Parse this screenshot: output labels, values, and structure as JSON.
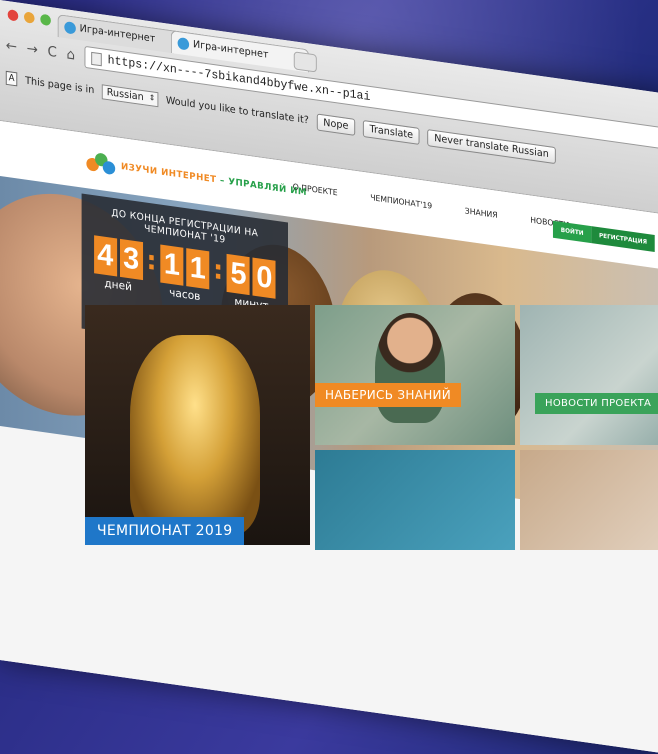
{
  "browser": {
    "tabs": [
      {
        "title": "Игра-интернет"
      },
      {
        "title": "Игра-интернет"
      }
    ],
    "url": "https://xn----7sbikand4bbyfwe.xn--p1ai",
    "translate_bar": {
      "prefix": "This page is in",
      "language": "Russian",
      "question": "Would you like to translate it?",
      "nope": "Nope",
      "translate": "Translate",
      "never": "Never translate Russian"
    }
  },
  "site": {
    "logo": {
      "part1": "ИЗУЧИ ИНТЕРНЕТ",
      "part2": " – УПРАВЛЯЙ ИМ"
    },
    "menu": [
      "О ПРОЕКТЕ",
      "ЧЕМПИОНАТ'19",
      "ЗНАНИЯ",
      "НОВОСТИ"
    ],
    "login": "ВОЙТИ",
    "register": "РЕГИСТРАЦИЯ",
    "countdown": {
      "title": "ДО КОНЦА РЕГИСТРАЦИИ НА ЧЕМПИОНАТ '19",
      "days": [
        "4",
        "3"
      ],
      "hours": [
        "1",
        "1"
      ],
      "minutes": [
        "5",
        "0"
      ],
      "days_label": "дней",
      "hours_label": "часов",
      "minutes_label": "минут"
    },
    "tiles": {
      "knowledge": "НАБЕРИСЬ ЗНАНИЙ",
      "news": "НОВОСТИ ПРОЕКТА",
      "championship": "ЧЕМПИОНАТ 2019"
    }
  },
  "colors": {
    "accent_orange": "#f08a24",
    "accent_green": "#27a04a",
    "accent_blue": "#1f77c9"
  }
}
